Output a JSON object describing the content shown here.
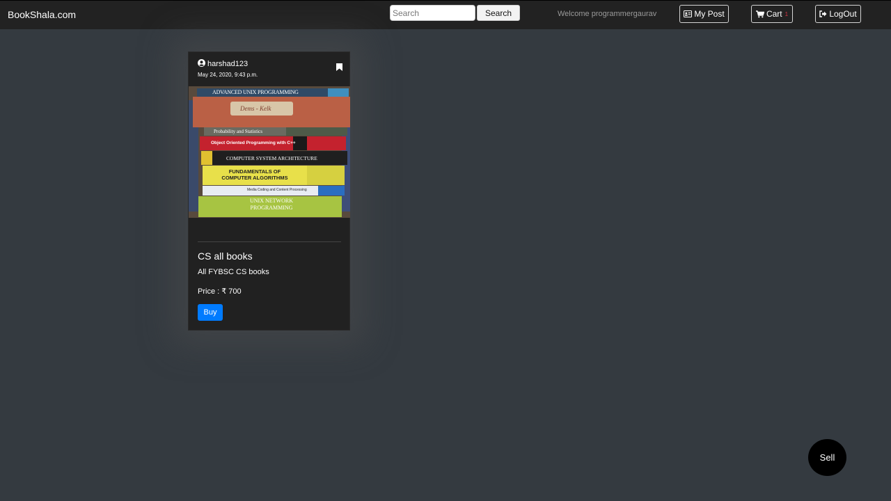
{
  "navbar": {
    "brand": "BookShala.com",
    "search": {
      "placeholder": "Search",
      "value": "",
      "button_label": "Search"
    },
    "welcome_text": "Welcome programmergaurav",
    "my_post_label": "My Post",
    "cart_label": "Cart",
    "cart_count": "1",
    "logout_label": "LogOut",
    "icons": {
      "my_post": "id-card-icon",
      "cart": "shopping-cart-icon",
      "logout": "sign-out-icon"
    }
  },
  "posts": [
    {
      "username": "harshad123",
      "date": "May 24, 2020, 9:43 p.m.",
      "image_book_spines": [
        "ADVANCED UNIX PROGRAMMING",
        "Probability and Statistics",
        "Object Oriented Programming with C++",
        "COMPUTER SYSTEM ARCHITECTURE",
        "FUNDAMENTALS OF COMPUTER ALGORITHMS",
        "Media Coding and Content Processing",
        "UNIX NETWORK PROGRAMMING"
      ],
      "image_handwriting": "Dems - Kelk",
      "title": "CS all books",
      "description": "All FYBSC CS books",
      "price": "Price : ₹ 700",
      "buy_label": "Buy",
      "icons": {
        "user": "user-circle-icon",
        "bookmark": "bookmark-icon"
      }
    }
  ],
  "sell_label": "Sell",
  "colors": {
    "navbar_bg": "#222222",
    "page_bg": "#343a40",
    "card_bg": "#212121",
    "buy_button": "#007bff",
    "cart_count": "#dc3545"
  }
}
